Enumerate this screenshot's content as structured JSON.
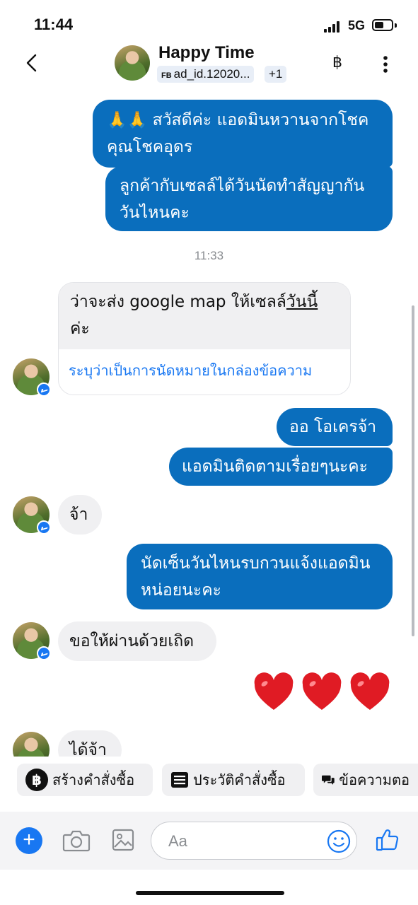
{
  "status": {
    "time": "11:44",
    "network": "5G",
    "battery_level": 0.55
  },
  "header": {
    "title": "Happy Time",
    "fb_tag": "FB",
    "ad_id": "ad_id.12020...",
    "extra_count": "+1",
    "baht_symbol": "฿"
  },
  "messages": {
    "out1": {
      "emoji": "🙏🙏",
      "line1": "สวัสดีค่ะ แอดมินหวานจากโชค",
      "line2": "คุณโชคอุดร"
    },
    "out2": {
      "line1": "ลูกค้ากับเซลล์ได้วันนัดทำสัญญากัน",
      "line2": "วันไหนคะ"
    },
    "timestamp": "11:33",
    "in1": {
      "line1_a": "ว่าจะส่ง google map ให้เซลล์",
      "line1_b": "วันนี้",
      "line2": "ค่ะ",
      "link": "ระบุว่าเป็นการนัดหมายในกล่องข้อความ"
    },
    "out3": "ออ โอเครจ้า",
    "out4": "แอดมินติดตามเรื่อยๆนะคะ",
    "in2": "จ้า",
    "out5": {
      "line1": "นัดเซ็นวันไหนรบกวนแจ้งแอดมิน",
      "line2": "หน่อยนะคะ"
    },
    "in3": "ขอให้ผ่านด้วยเถิด",
    "hearts": [
      "❤",
      "❤",
      "❤"
    ],
    "in4": "ได้จ้า"
  },
  "quick_actions": [
    {
      "label": "สร้างคำสั่งซื้อ",
      "icon": "baht-circle-icon"
    },
    {
      "label": "ประวัติคำสั่งซื้อ",
      "icon": "list-icon"
    },
    {
      "label": "ข้อความตอ",
      "icon": "chat-bubbles-icon"
    }
  ],
  "composer": {
    "placeholder": "Aa",
    "plus": "+"
  },
  "colors": {
    "outgoing": "#0a6ebd",
    "incoming": "#f0f0f2",
    "accent": "#1877f2"
  }
}
